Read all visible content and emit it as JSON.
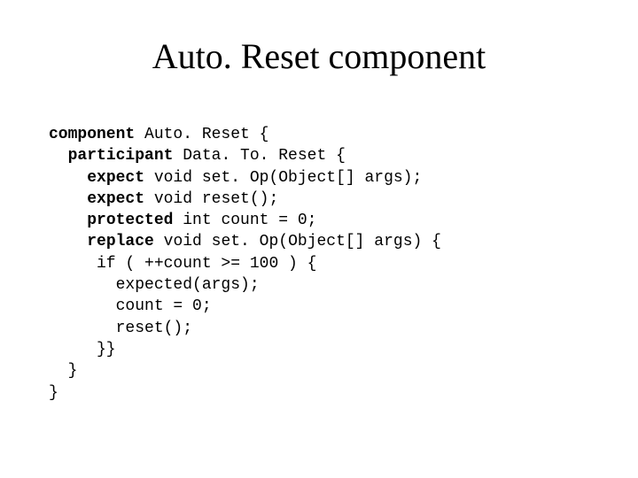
{
  "title": "Auto. Reset component",
  "code": {
    "l1_kw": "component",
    "l1_rest": " Auto. Reset {",
    "l2_kw": "participant",
    "l2_rest": " Data. To. Reset {",
    "l3_kw": "expect",
    "l3_rest": " void set. Op(Object[] args);",
    "l4_kw": "expect",
    "l4_rest": " void reset();",
    "l5_kw": "protected",
    "l5_rest": " int count = 0;",
    "l6_kw": "replace",
    "l6_rest": " void set. Op(Object[] args) {",
    "l7": "     if ( ++count >= 100 ) {",
    "l8": "       expected(args);",
    "l9": "       count = 0;",
    "l10": "       reset();",
    "l11": "     }}",
    "l12": "  }",
    "l13": "}"
  }
}
